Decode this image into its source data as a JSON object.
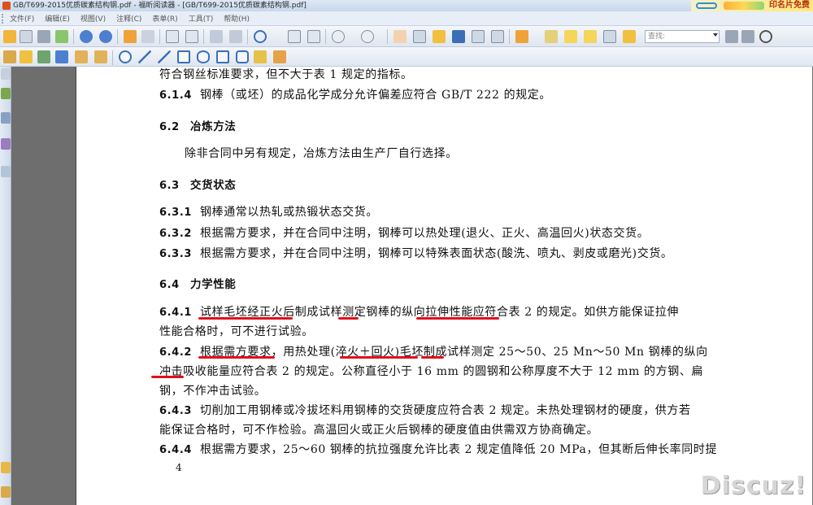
{
  "window": {
    "title": "GB/T699-2015优质碳素结构钢.pdf - 福昕阅读器 - [GB/T699-2015优质碳素结构钢.pdf]",
    "ad_text": "印名片免费"
  },
  "menu": [
    "文件(F)",
    "编辑(E)",
    "视图(V)",
    "注释(C)",
    "表单(R)",
    "工具(T)",
    "帮助(H)"
  ],
  "toolbar": {
    "search_placeholder": "查找:"
  },
  "document": {
    "lines": [
      {
        "num": "",
        "text": "符合钢丝标准要求，但不大于表 1 规定的指标。"
      },
      {
        "num": "6.1.4",
        "text": "钢棒（或坯）的成品化学成分允许偏差应符合 GB/T 222 的规定。"
      },
      {
        "num": "6.2",
        "text": "冶炼方法"
      },
      {
        "num": "",
        "text": "除非合同中另有规定，冶炼方法由生产厂自行选择。"
      },
      {
        "num": "6.3",
        "text": "交货状态"
      },
      {
        "num": "6.3.1",
        "text": "钢棒通常以热轧或热锻状态交货。"
      },
      {
        "num": "6.3.2",
        "text": "根据需方要求，并在合同中注明，钢棒可以热处理(退火、正火、高温回火)状态交货。"
      },
      {
        "num": "6.3.3",
        "text": "根据需方要求，并在合同中注明，钢棒可以特殊表面状态(酸洗、喷丸、剥皮或磨光)交货。"
      },
      {
        "num": "6.4",
        "text": "力学性能"
      },
      {
        "num": "6.4.1",
        "text": "试样毛坯经正火后制成试样测定钢棒的纵向拉伸性能应符合表 2 的规定。如供方能保证拉伸"
      },
      {
        "num": "",
        "text": "性能合格时，可不进行试验。"
      },
      {
        "num": "6.4.2",
        "text": "根据需方要求，用热处理(淬火＋回火)毛坯制成试样测定 25～50、25 Mn～50 Mn 钢棒的纵向"
      },
      {
        "num": "",
        "text": "冲击吸收能量应符合表 2 的规定。公称直径小于 16 mm 的圆钢和公称厚度不大于 12 mm 的方钢、扁"
      },
      {
        "num": "",
        "text": "钢，不作冲击试验。"
      },
      {
        "num": "6.4.3",
        "text": "切削加工用钢棒或冷拔坯料用钢棒的交货硬度应符合表 2 规定。未热处理钢材的硬度，供方若"
      },
      {
        "num": "",
        "text": "能保证合格时，可不作检验。高温回火或正火后钢棒的硬度值由供需双方协商确定。"
      },
      {
        "num": "6.4.4",
        "text": "根据需方要求，25～60 钢棒的抗拉强度允许比表 2 规定值降低 20 MPa，但其断后伸长率同时提"
      }
    ],
    "page_number": "4"
  },
  "watermark": "Discuz!",
  "colors": {
    "annotation": "#e0111a",
    "page_bg": "#ffffff",
    "workspace_bg": "#6e6e6e"
  }
}
